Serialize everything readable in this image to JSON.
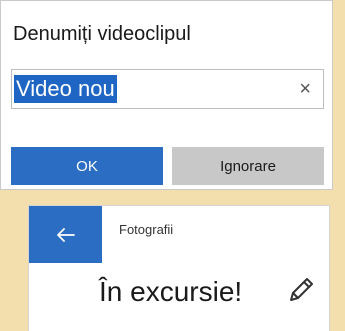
{
  "dialog": {
    "title": "Denumiți videoclipul",
    "input_value": "Video nou",
    "clear_icon": "close-icon",
    "ok_label": "OK",
    "cancel_label": "Ignorare"
  },
  "photos_app": {
    "back_icon": "back-arrow-icon",
    "app_title": "Fotografii",
    "album_title": "În excursie!",
    "edit_icon": "pencil-icon"
  },
  "colors": {
    "accent": "#2a6dc2",
    "selection": "#1f66c4",
    "secondary_button": "#c8c8c8",
    "page_background": "#f3dfae"
  }
}
